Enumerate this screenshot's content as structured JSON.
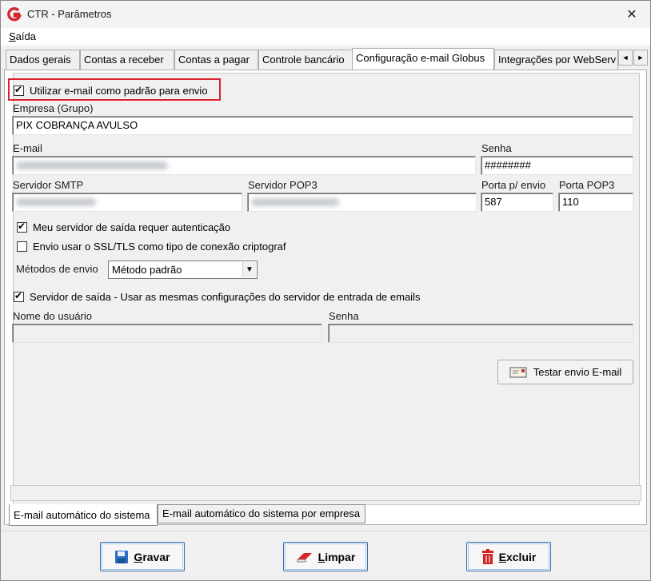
{
  "window": {
    "title": "CTR - Parâmetros",
    "close_glyph": "✕"
  },
  "menu": {
    "saida_first": "S",
    "saida_rest": "aída"
  },
  "tabs": [
    {
      "label": "Dados gerais"
    },
    {
      "label": "Contas a receber"
    },
    {
      "label": "Contas a pagar"
    },
    {
      "label": "Controle bancário"
    },
    {
      "label": "Configuração e-mail Globus",
      "active": true
    },
    {
      "label": "Integrações por WebServ"
    }
  ],
  "tab_scroll": {
    "left": "◄",
    "right": "►"
  },
  "form": {
    "use_email_default": {
      "label": "Utilizar e-mail como padrão para envio",
      "checked": true
    },
    "empresa": {
      "label": "Empresa (Grupo)",
      "value": "PIX COBRANÇA AVULSO"
    },
    "email": {
      "label": "E-mail"
    },
    "senha": {
      "label": "Senha",
      "value": "########"
    },
    "smtp": {
      "label": "Servidor SMTP"
    },
    "pop3": {
      "label": "Servidor POP3"
    },
    "porta_envio": {
      "label": "Porta p/ envio",
      "value": "587"
    },
    "porta_pop3": {
      "label": "Porta POP3",
      "value": "110"
    },
    "auth_required": {
      "label": "Meu servidor de saída requer autenticação",
      "checked": true
    },
    "ssl_tls": {
      "label": "Envio usar o SSL/TLS como tipo de conexão criptograf",
      "checked": false
    },
    "metodos": {
      "label": "Métodos de envio",
      "value": "Método padrão"
    },
    "same_config": {
      "label": "Servidor de saída - Usar as mesmas configurações do servidor de entrada de emails",
      "checked": true
    },
    "usuario": {
      "label": "Nome do usuário"
    },
    "senha2": {
      "label": "Senha"
    },
    "test_button": "Testar envio E-mail"
  },
  "bottom_tabs": [
    {
      "label": "E-mail automático do sistema",
      "active": true
    },
    {
      "label": "E-mail automático do sistema por empresa"
    }
  ],
  "buttons": {
    "gravar_first": "G",
    "gravar_rest": "ravar",
    "limpar_first": "L",
    "limpar_rest": "impar",
    "excluir_first": "E",
    "excluir_rest": "xcluir"
  },
  "check_glyph": "✔",
  "dropdown_glyph": "▼",
  "colors": {
    "highlight_border": "#d9232d",
    "app_icon": "#d4262c",
    "save_icon": "#2a6fc4",
    "delete_icon": "#d32020"
  },
  "icons": [
    "app-logo-icon",
    "close-icon",
    "envelope-icon",
    "floppy-disk-icon",
    "eraser-icon",
    "trash-icon"
  ]
}
